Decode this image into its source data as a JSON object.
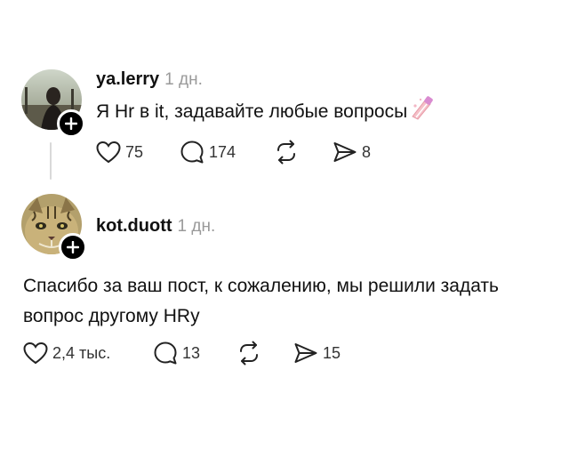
{
  "posts": [
    {
      "username": "ya.lerry",
      "time": "1 дн.",
      "text": "Я Hr в it, задавайте любые вопросы",
      "emoji_icon": "nail-polish-icon",
      "likes": "75",
      "comments": "174",
      "shares": "8"
    },
    {
      "username": "kot.duott",
      "time": "1 дн.",
      "text_line1": "Спасибо за ваш пост, к сожалению, мы решили задать",
      "text_line2": "вопрос другому HRy",
      "likes": "2,4 тыс.",
      "comments": "13",
      "shares": "15"
    }
  ],
  "icons": {
    "like": "heart-icon",
    "comment": "comment-bubble-icon",
    "repost": "repost-icon",
    "share": "send-icon",
    "follow": "plus-icon"
  },
  "colors": {
    "text": "#111111",
    "muted": "#9a9a9a",
    "badge": "#000000"
  }
}
